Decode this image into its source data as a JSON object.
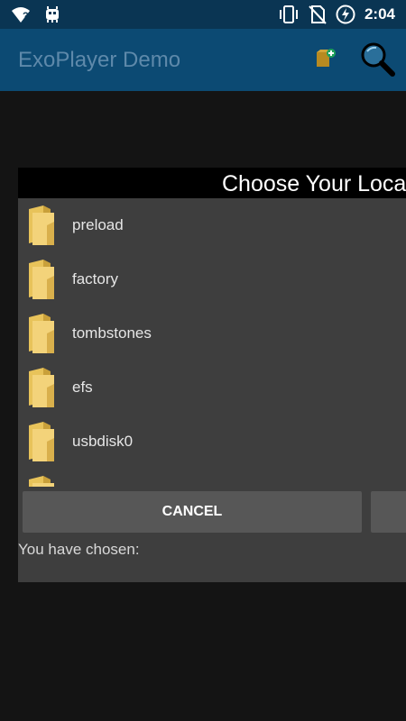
{
  "status_bar": {
    "time": "2:04",
    "wifi_hint": "?",
    "icons": [
      "wifi-unknown-icon",
      "debug-bug-icon",
      "vibrate-icon",
      "no-sim-icon",
      "battery-charging-icon"
    ]
  },
  "action_bar": {
    "title": "ExoPlayer Demo",
    "actions": [
      "add-file-icon",
      "search-icon"
    ]
  },
  "dialog": {
    "title": "Choose Your Location",
    "items": [
      {
        "label": "preload",
        "icon": "folder-icon"
      },
      {
        "label": "factory",
        "icon": "folder-icon"
      },
      {
        "label": "tombstones",
        "icon": "folder-icon"
      },
      {
        "label": "efs",
        "icon": "folder-icon"
      },
      {
        "label": "usbdisk0",
        "icon": "folder-icon"
      }
    ],
    "cancel_label": "CANCEL",
    "chosen_label": "You have chosen:"
  },
  "colors": {
    "status_bar": "#0a3553",
    "action_bar": "#0c4a73",
    "title_text": "#5e89aa",
    "background": "#141414",
    "dialog": "#3e3e3e",
    "button": "#575757"
  }
}
